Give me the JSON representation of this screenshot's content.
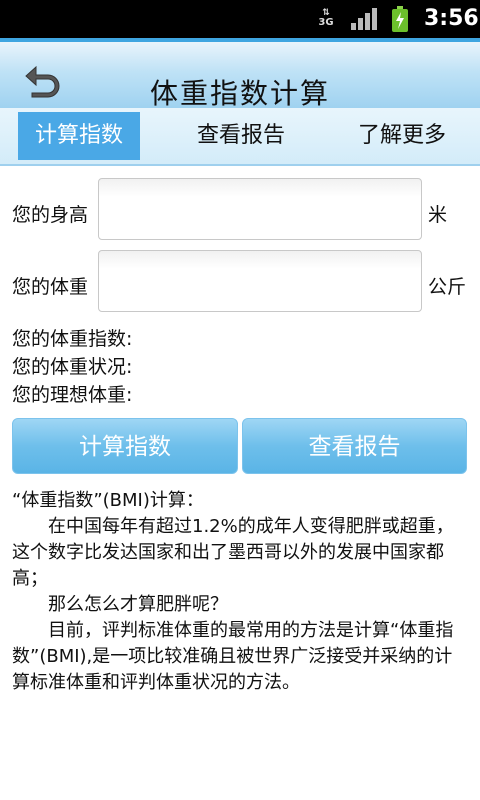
{
  "status_bar": {
    "network": "3G",
    "time": "3:56"
  },
  "header": {
    "title": "体重指数计算",
    "back_icon": "back-arrow-icon"
  },
  "tabs": [
    {
      "label": "计算指数",
      "active": true
    },
    {
      "label": "查看报告",
      "active": false
    },
    {
      "label": "了解更多",
      "active": false
    }
  ],
  "form": {
    "height_label": "您的身高",
    "height_value": "",
    "height_unit": "米",
    "weight_label": "您的体重",
    "weight_value": "",
    "weight_unit": "公斤"
  },
  "results": {
    "bmi_label": "您的体重指数:",
    "status_label": "您的体重状况:",
    "ideal_label": "您的理想体重:"
  },
  "buttons": {
    "calculate": "计算指数",
    "report": "查看报告"
  },
  "info": {
    "heading": "“体重指数”(BMI)计算：",
    "p1": "在中国每年有超过1.2%的成年人变得肥胖或超重，这个数字比发达国家和出了墨西哥以外的发展中国家都高；",
    "p2": "那么怎么才算肥胖呢？",
    "p3": "目前，评判标准体重的最常用的方法是计算“体重指数”(BMI),是一项比较准确且被世界广泛接受并采纳的计算标准体重和评判体重状况的方法。"
  },
  "colors": {
    "accent": "#4aa8e6",
    "button": "#6ebfeb",
    "status_bar": "#000000"
  }
}
